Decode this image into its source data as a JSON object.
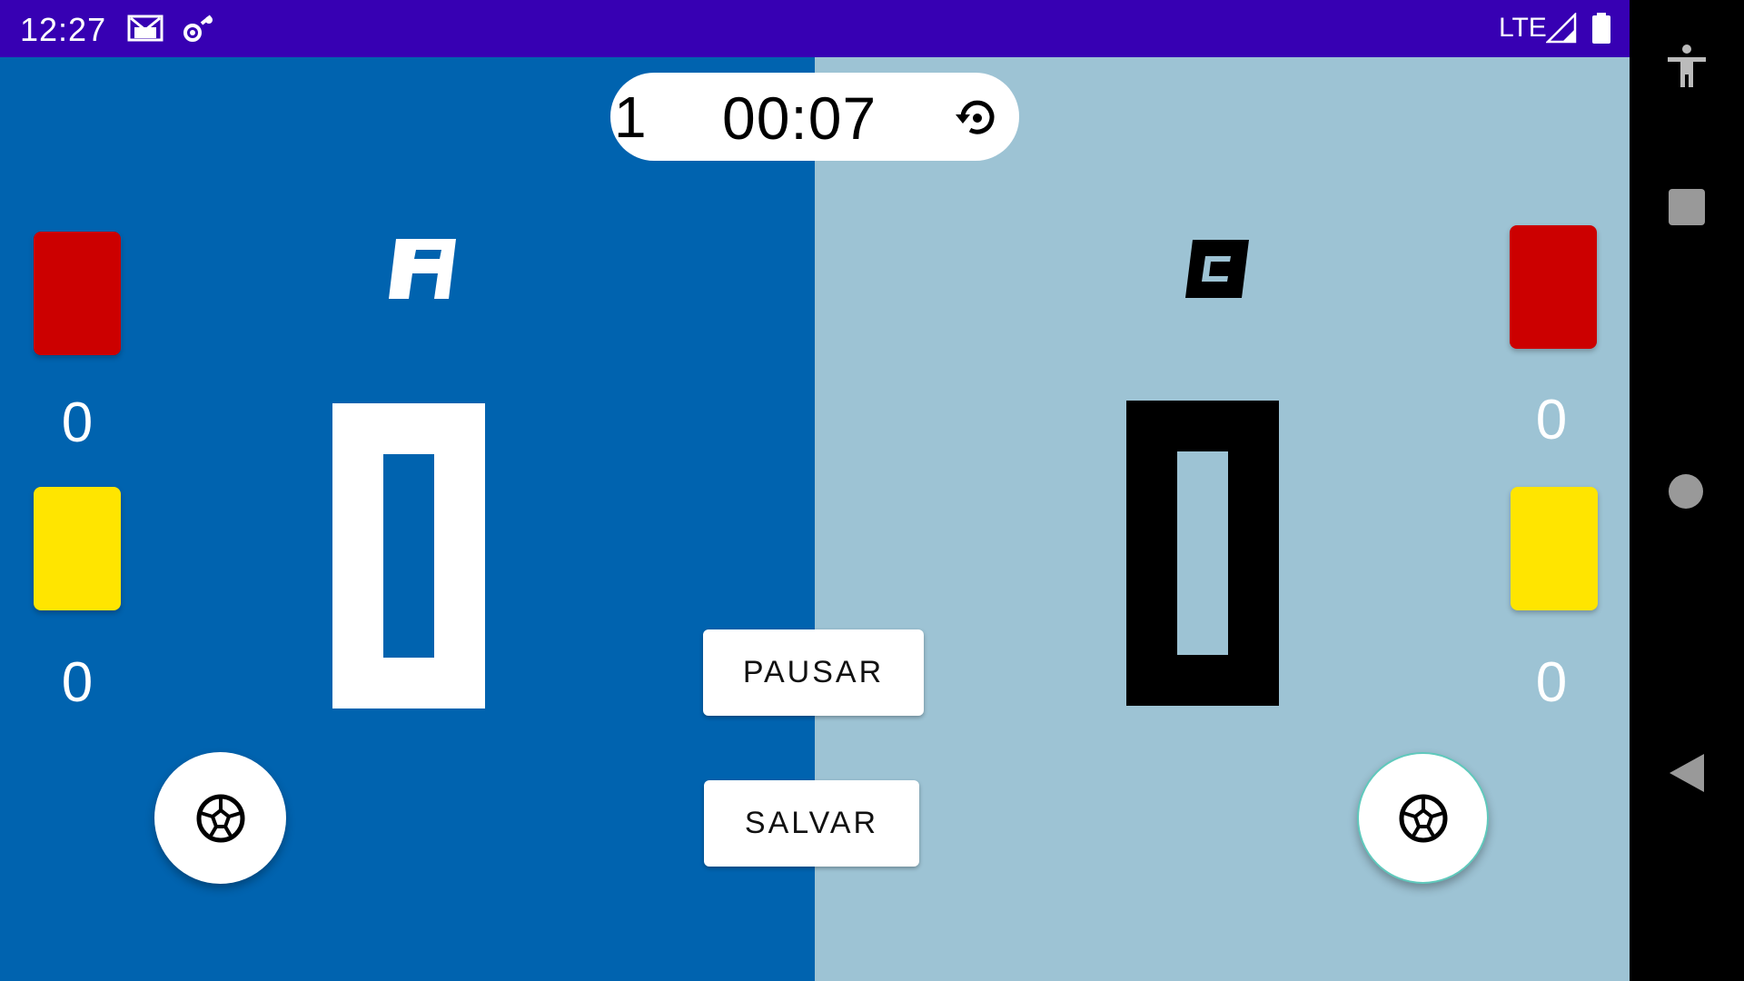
{
  "status_bar": {
    "time": "12:27",
    "network": "LTE",
    "icons": [
      "gmail-icon",
      "settings-sync-icon",
      "signal-icon",
      "battery-icon"
    ]
  },
  "timer": {
    "period": "1",
    "time": "00:07",
    "reset_icon": "restart-icon"
  },
  "team_left": {
    "logo_letter": "A",
    "score": "0",
    "red_cards": "0",
    "yellow_cards": "0",
    "background": "#0063AF"
  },
  "team_right": {
    "logo_letter": "C",
    "score": "0",
    "red_cards": "0",
    "yellow_cards": "0",
    "background": "#9DC3D4"
  },
  "buttons": {
    "pause_label": "PAUSAR",
    "save_label": "SALVAR"
  },
  "colors": {
    "status_bar": "#3700B3",
    "red_card": "#CC0000",
    "yellow_card": "#FFE500"
  },
  "navigation": [
    "accessibility-icon",
    "recents-icon",
    "home-icon",
    "back-icon"
  ]
}
